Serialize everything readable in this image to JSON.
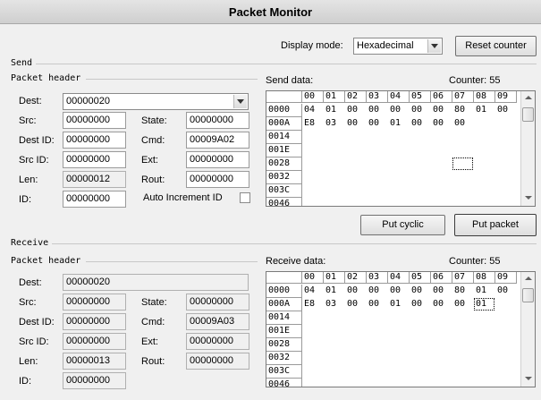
{
  "window": {
    "title": "Packet Monitor"
  },
  "toolbar": {
    "display_mode_label": "Display mode:",
    "display_mode_value": "Hexadecimal",
    "reset_counter_label": "Reset counter"
  },
  "send": {
    "group_label": "Send",
    "header_group_label": "Packet header",
    "fields": {
      "dest": {
        "label": "Dest:",
        "value": "00000020"
      },
      "src": {
        "label": "Src:",
        "value": "00000000"
      },
      "dest_id": {
        "label": "Dest ID:",
        "value": "00000000"
      },
      "src_id": {
        "label": "Src ID:",
        "value": "00000000"
      },
      "len": {
        "label": "Len:",
        "value": "00000012"
      },
      "id": {
        "label": "ID:",
        "value": "00000000"
      },
      "state": {
        "label": "State:",
        "value": "00000000"
      },
      "cmd": {
        "label": "Cmd:",
        "value": "00009A02"
      },
      "ext": {
        "label": "Ext:",
        "value": "00000000"
      },
      "rout": {
        "label": "Rout:",
        "value": "00000000"
      }
    },
    "auto_increment_label": "Auto Increment ID",
    "data_label": "Send data:",
    "counter_label": "Counter: 55",
    "columns": [
      "00",
      "01",
      "02",
      "03",
      "04",
      "05",
      "06",
      "07",
      "08",
      "09"
    ],
    "rows": [
      {
        "addr": "0000",
        "cells": [
          "04",
          "01",
          "00",
          "00",
          "00",
          "00",
          "00",
          "80",
          "01",
          "00"
        ]
      },
      {
        "addr": "000A",
        "cells": [
          "E8",
          "03",
          "00",
          "00",
          "01",
          "00",
          "00",
          "00",
          "",
          ""
        ]
      },
      {
        "addr": "0014",
        "cells": [
          "",
          "",
          "",
          "",
          "",
          "",
          "",
          "",
          "",
          ""
        ]
      },
      {
        "addr": "001E",
        "cells": [
          "",
          "",
          "",
          "",
          "",
          "",
          "",
          "",
          "",
          ""
        ]
      },
      {
        "addr": "0028",
        "cells": [
          "",
          "",
          "",
          "",
          "",
          "",
          "",
          "",
          "",
          ""
        ]
      },
      {
        "addr": "0032",
        "cells": [
          "",
          "",
          "",
          "",
          "",
          "",
          "",
          "",
          "",
          ""
        ]
      },
      {
        "addr": "003C",
        "cells": [
          "",
          "",
          "",
          "",
          "",
          "",
          "",
          "",
          "",
          ""
        ]
      },
      {
        "addr": "0046",
        "cells": [
          "",
          "",
          "",
          "",
          "",
          "",
          "",
          "",
          "",
          ""
        ]
      }
    ],
    "put_cyclic_label": "Put cyclic",
    "put_packet_label": "Put packet"
  },
  "receive": {
    "group_label": "Receive",
    "header_group_label": "Packet header",
    "fields": {
      "dest": {
        "label": "Dest:",
        "value": "00000020"
      },
      "src": {
        "label": "Src:",
        "value": "00000000"
      },
      "dest_id": {
        "label": "Dest ID:",
        "value": "00000000"
      },
      "src_id": {
        "label": "Src ID:",
        "value": "00000000"
      },
      "len": {
        "label": "Len:",
        "value": "00000013"
      },
      "id": {
        "label": "ID:",
        "value": "00000000"
      },
      "state": {
        "label": "State:",
        "value": "00000000"
      },
      "cmd": {
        "label": "Cmd:",
        "value": "00009A03"
      },
      "ext": {
        "label": "Ext:",
        "value": "00000000"
      },
      "rout": {
        "label": "Rout:",
        "value": "00000000"
      }
    },
    "data_label": "Receive data:",
    "counter_label": "Counter: 55",
    "columns": [
      "00",
      "01",
      "02",
      "03",
      "04",
      "05",
      "06",
      "07",
      "08",
      "09"
    ],
    "rows": [
      {
        "addr": "0000",
        "cells": [
          "04",
          "01",
          "00",
          "00",
          "00",
          "00",
          "00",
          "80",
          "01",
          "00"
        ]
      },
      {
        "addr": "000A",
        "cells": [
          "E8",
          "03",
          "00",
          "00",
          "01",
          "00",
          "00",
          "00",
          "01",
          ""
        ]
      },
      {
        "addr": "0014",
        "cells": [
          "",
          "",
          "",
          "",
          "",
          "",
          "",
          "",
          "",
          ""
        ]
      },
      {
        "addr": "001E",
        "cells": [
          "",
          "",
          "",
          "",
          "",
          "",
          "",
          "",
          "",
          ""
        ]
      },
      {
        "addr": "0028",
        "cells": [
          "",
          "",
          "",
          "",
          "",
          "",
          "",
          "",
          "",
          ""
        ]
      },
      {
        "addr": "0032",
        "cells": [
          "",
          "",
          "",
          "",
          "",
          "",
          "",
          "",
          "",
          ""
        ]
      },
      {
        "addr": "003C",
        "cells": [
          "",
          "",
          "",
          "",
          "",
          "",
          "",
          "",
          "",
          ""
        ]
      },
      {
        "addr": "0046",
        "cells": [
          "",
          "",
          "",
          "",
          "",
          "",
          "",
          "",
          "",
          ""
        ]
      }
    ]
  }
}
